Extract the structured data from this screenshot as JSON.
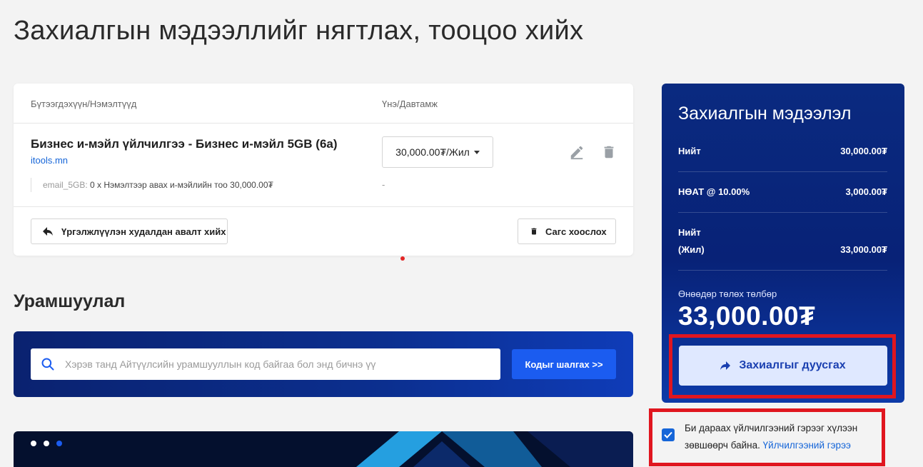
{
  "page": {
    "title": "Захиалгын мэдээллийг нягтлах, тооцоо хийх"
  },
  "cart": {
    "header": {
      "product_col": "Бүтээгдэхүүн/Нэмэлтүүд",
      "price_col": "Үнэ/Давтамж"
    },
    "item": {
      "name": "Бизнес и-мэйл үйлчилгээ - Бизнес и-мэйл 5GB (6a)",
      "domain": "itools.mn",
      "addon_key": "email_5GB:",
      "addon_value": "0 x Нэмэлтээр авах и-мэйлийн тоо 30,000.00₮",
      "price_option": "30,000.00₮/Жил",
      "addon_price": "-"
    },
    "buttons": {
      "continue_label": "Үргэлжлүүлэн худалдан авалт хийх",
      "clear_label": "Сагс хоослох"
    }
  },
  "promo": {
    "title": "Урамшуулал",
    "input_placeholder": "Хэрэв танд Айтүүлсийн урамшууллын код байгаа бол энд бичнэ үү",
    "button_label": "Кодыг шалгах >>"
  },
  "summary": {
    "title": "Захиалгын мэдээлэл",
    "rows": [
      {
        "label": "Нийт",
        "value": "30,000.00₮"
      },
      {
        "label": "НӨАТ @ 10.00%",
        "value": "3,000.00₮"
      },
      {
        "label": "Нийт",
        "value": ""
      },
      {
        "label": "(Жил)",
        "value": "33,000.00₮"
      }
    ],
    "today_label": "Өнөөдөр төлөх төлбөр",
    "today_amount": "33,000.00₮",
    "finish_label": "Захиалгыг дуусгах"
  },
  "terms": {
    "text": "Би дараах үйлчилгээний гэрээг хүлээн зөвшөөрч байна.",
    "link": "Үйлчилгээний гэрээ",
    "checked": true
  },
  "colors": {
    "accent": "#1b5cf0",
    "navy": "#0a2a80",
    "highlight": "#e0161f",
    "link": "#1565d8"
  }
}
